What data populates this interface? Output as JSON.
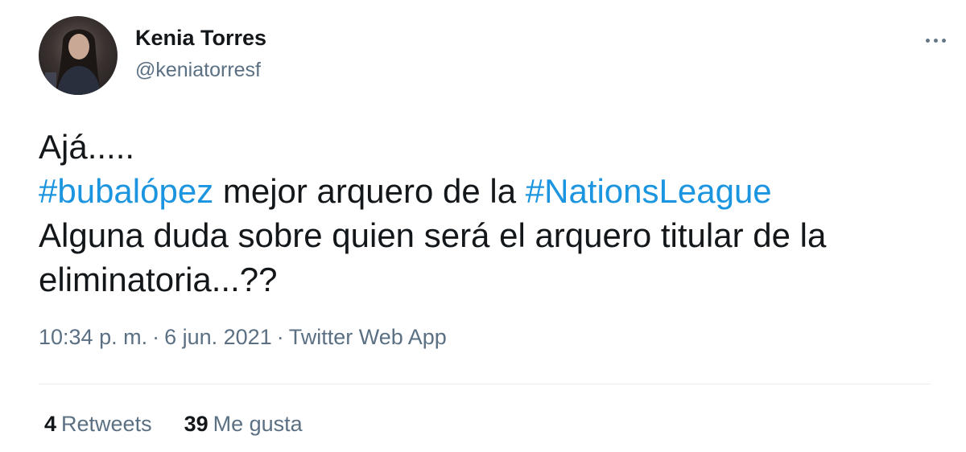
{
  "author": {
    "name": "Kenia Torres",
    "handle": "@keniatorresf"
  },
  "tweet": {
    "line1": "Ajá.....",
    "line2": {
      "hashtag1": "#bubalópez",
      "middle": " mejor arquero de la ",
      "hashtag2": "#NationsLeague"
    },
    "line3": "Alguna duda sobre quien será el arquero titular de la",
    "line4": "eliminatoria...??"
  },
  "meta": {
    "time": "10:34 p. m.",
    "date": "6 jun. 2021",
    "separator": "·",
    "source": "Twitter Web App"
  },
  "stats": {
    "retweets_count": "4",
    "retweets_label": "Retweets",
    "likes_count": "39",
    "likes_label": "Me gusta"
  },
  "colors": {
    "hashtag": "#1b95e0",
    "secondary_text": "#5b7083",
    "primary_text": "#14171a"
  },
  "icons": {
    "more": "more-options-icon"
  }
}
